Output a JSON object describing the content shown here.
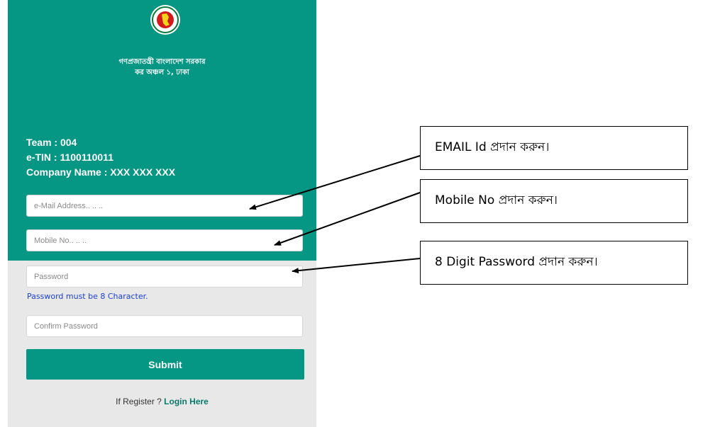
{
  "header": {
    "gov_name": "গণপ্রজাতন্ত্রী বাংলাদেশ সরকার",
    "office": "কর অঞ্চল ১, ঢাকা",
    "emblem_icon": "bangladesh-government-seal-icon"
  },
  "info": {
    "team": "Team : 004",
    "etin": "e-TIN : 1100110011",
    "company": "Company Name : XXX XXX XXX"
  },
  "form": {
    "email_placeholder": "e-Mail Address.. .. ..",
    "mobile_placeholder": "Mobile No.. .. ..",
    "password_placeholder": "Password",
    "password_hint": "Password must be 8 Character.",
    "confirm_placeholder": "Confirm Password",
    "submit_label": "Submit",
    "login_prefix": "If Register ? ",
    "login_link": "Login Here"
  },
  "callouts": {
    "email": "EMAIL Id প্রদান করুন।",
    "mobile": "Mobile No প্রদান করুন।",
    "password": "8 Digit Password প্রদান করুন।"
  },
  "colors": {
    "primary": "#069684",
    "form_bg": "#e8e8e8",
    "hint": "#1a3fcf"
  }
}
